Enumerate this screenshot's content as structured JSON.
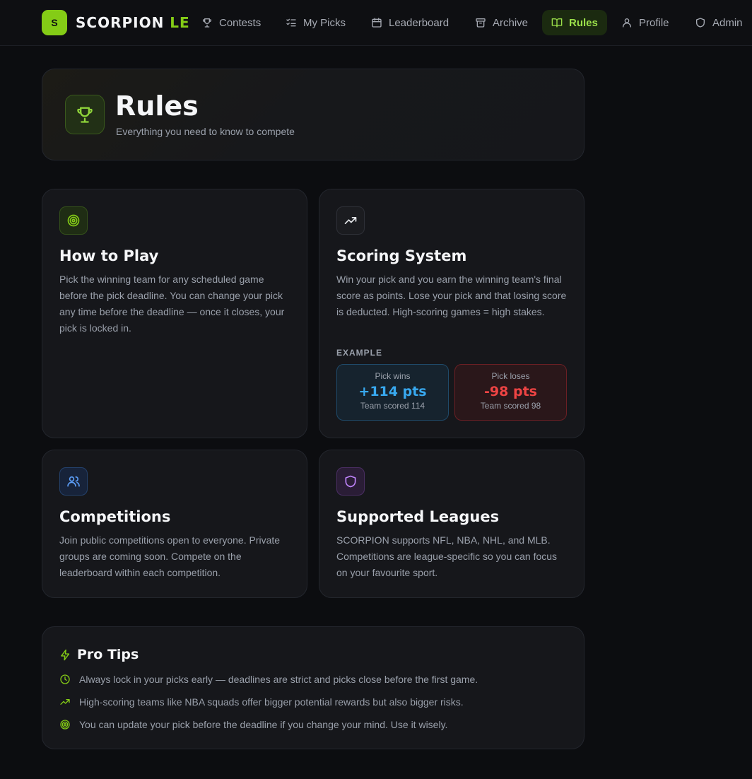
{
  "brand": {
    "badge": "S",
    "name_main": "SCORPION",
    "name_accent": " LE"
  },
  "nav": {
    "contests": "Contests",
    "my_picks": "My Picks",
    "leaderboard": "Leaderboard",
    "archive": "Archive",
    "rules": "Rules",
    "profile": "Profile",
    "admin": "Admin"
  },
  "hero": {
    "title": "Rules",
    "subtitle": "Everything you need to know to compete"
  },
  "cards": {
    "how_to_play": {
      "title": "How to Play",
      "body": "Pick the winning team for any scheduled game before the pick deadline. You can change your pick any time before the deadline — once it closes, your pick is locked in."
    },
    "scoring": {
      "title": "Scoring System",
      "body": "Win your pick and you earn the winning team's final score as points. Lose your pick and that losing score is deducted. High-scoring games = high stakes.",
      "example_label": "EXAMPLE",
      "win": {
        "label": "Pick wins",
        "points": "+114 pts",
        "note": "Team scored 114"
      },
      "lose": {
        "label": "Pick loses",
        "points": "-98 pts",
        "note": "Team scored 98"
      }
    },
    "competitions": {
      "title": "Competitions",
      "body": "Join public competitions open to everyone. Private groups are coming soon. Compete on the leaderboard within each competition."
    },
    "leagues": {
      "title": "Supported Leagues",
      "body": "SCORPION supports NFL, NBA, NHL, and MLB. Competitions are league-specific so you can focus on your favourite sport."
    }
  },
  "tips": {
    "title": "Pro Tips",
    "items": [
      "Always lock in your picks early — deadlines are strict and picks close before the first game.",
      "High-scoring teams like NBA squads offer bigger potential rewards but also bigger risks.",
      "You can update your pick before the deadline if you change your mind. Use it wisely."
    ]
  },
  "colors": {
    "accent": "#84cc16",
    "background": "#0c0d10",
    "card": "#16171b",
    "win": "#38a9f0",
    "lose": "#ef4444"
  },
  "icons": {
    "nav": [
      "trophy-icon",
      "checklist-icon",
      "calendar-icon",
      "archive-icon",
      "book-open-icon",
      "user-icon",
      "shield-icon"
    ],
    "cards": [
      "target-icon",
      "trending-up-icon",
      "users-icon",
      "shield-icon"
    ],
    "tips": [
      "zap-icon",
      "clock-icon",
      "trending-up-icon",
      "target-icon"
    ]
  }
}
